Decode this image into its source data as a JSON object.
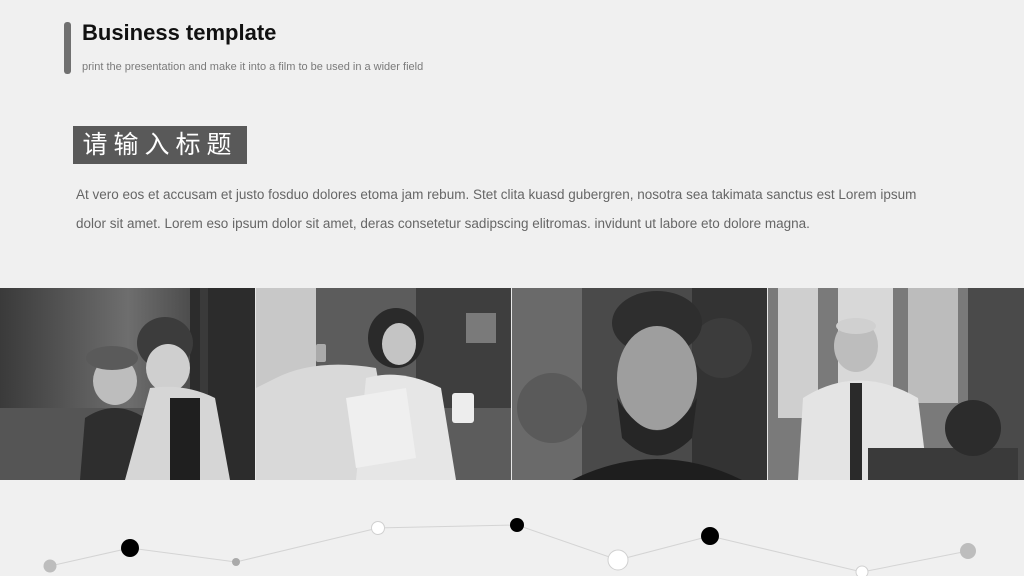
{
  "header": {
    "title": "Business template",
    "subtitle": "print the presentation and make it into a film to be used in a wider field"
  },
  "section": {
    "heading": "请输入标题",
    "body": "At vero eos et accusam et justo fosduo dolores etoma jam rebum. Stet clita kuasd gubergren, nosotra sea takimata sanctus est Lorem ipsum dolor sit amet. Lorem eso ipsum dolor sit amet, deras consetetur sadipscing elitromas. invidunt ut labore eto dolore magna."
  },
  "photos": [
    {
      "name": "photo-children"
    },
    {
      "name": "photo-woman-phone"
    },
    {
      "name": "photo-bearded-man"
    },
    {
      "name": "photo-older-man"
    }
  ],
  "colors": {
    "background": "#f0f0f0",
    "accent": "#707070",
    "heading_box": "#595959",
    "title": "#111111",
    "body": "#666666"
  }
}
